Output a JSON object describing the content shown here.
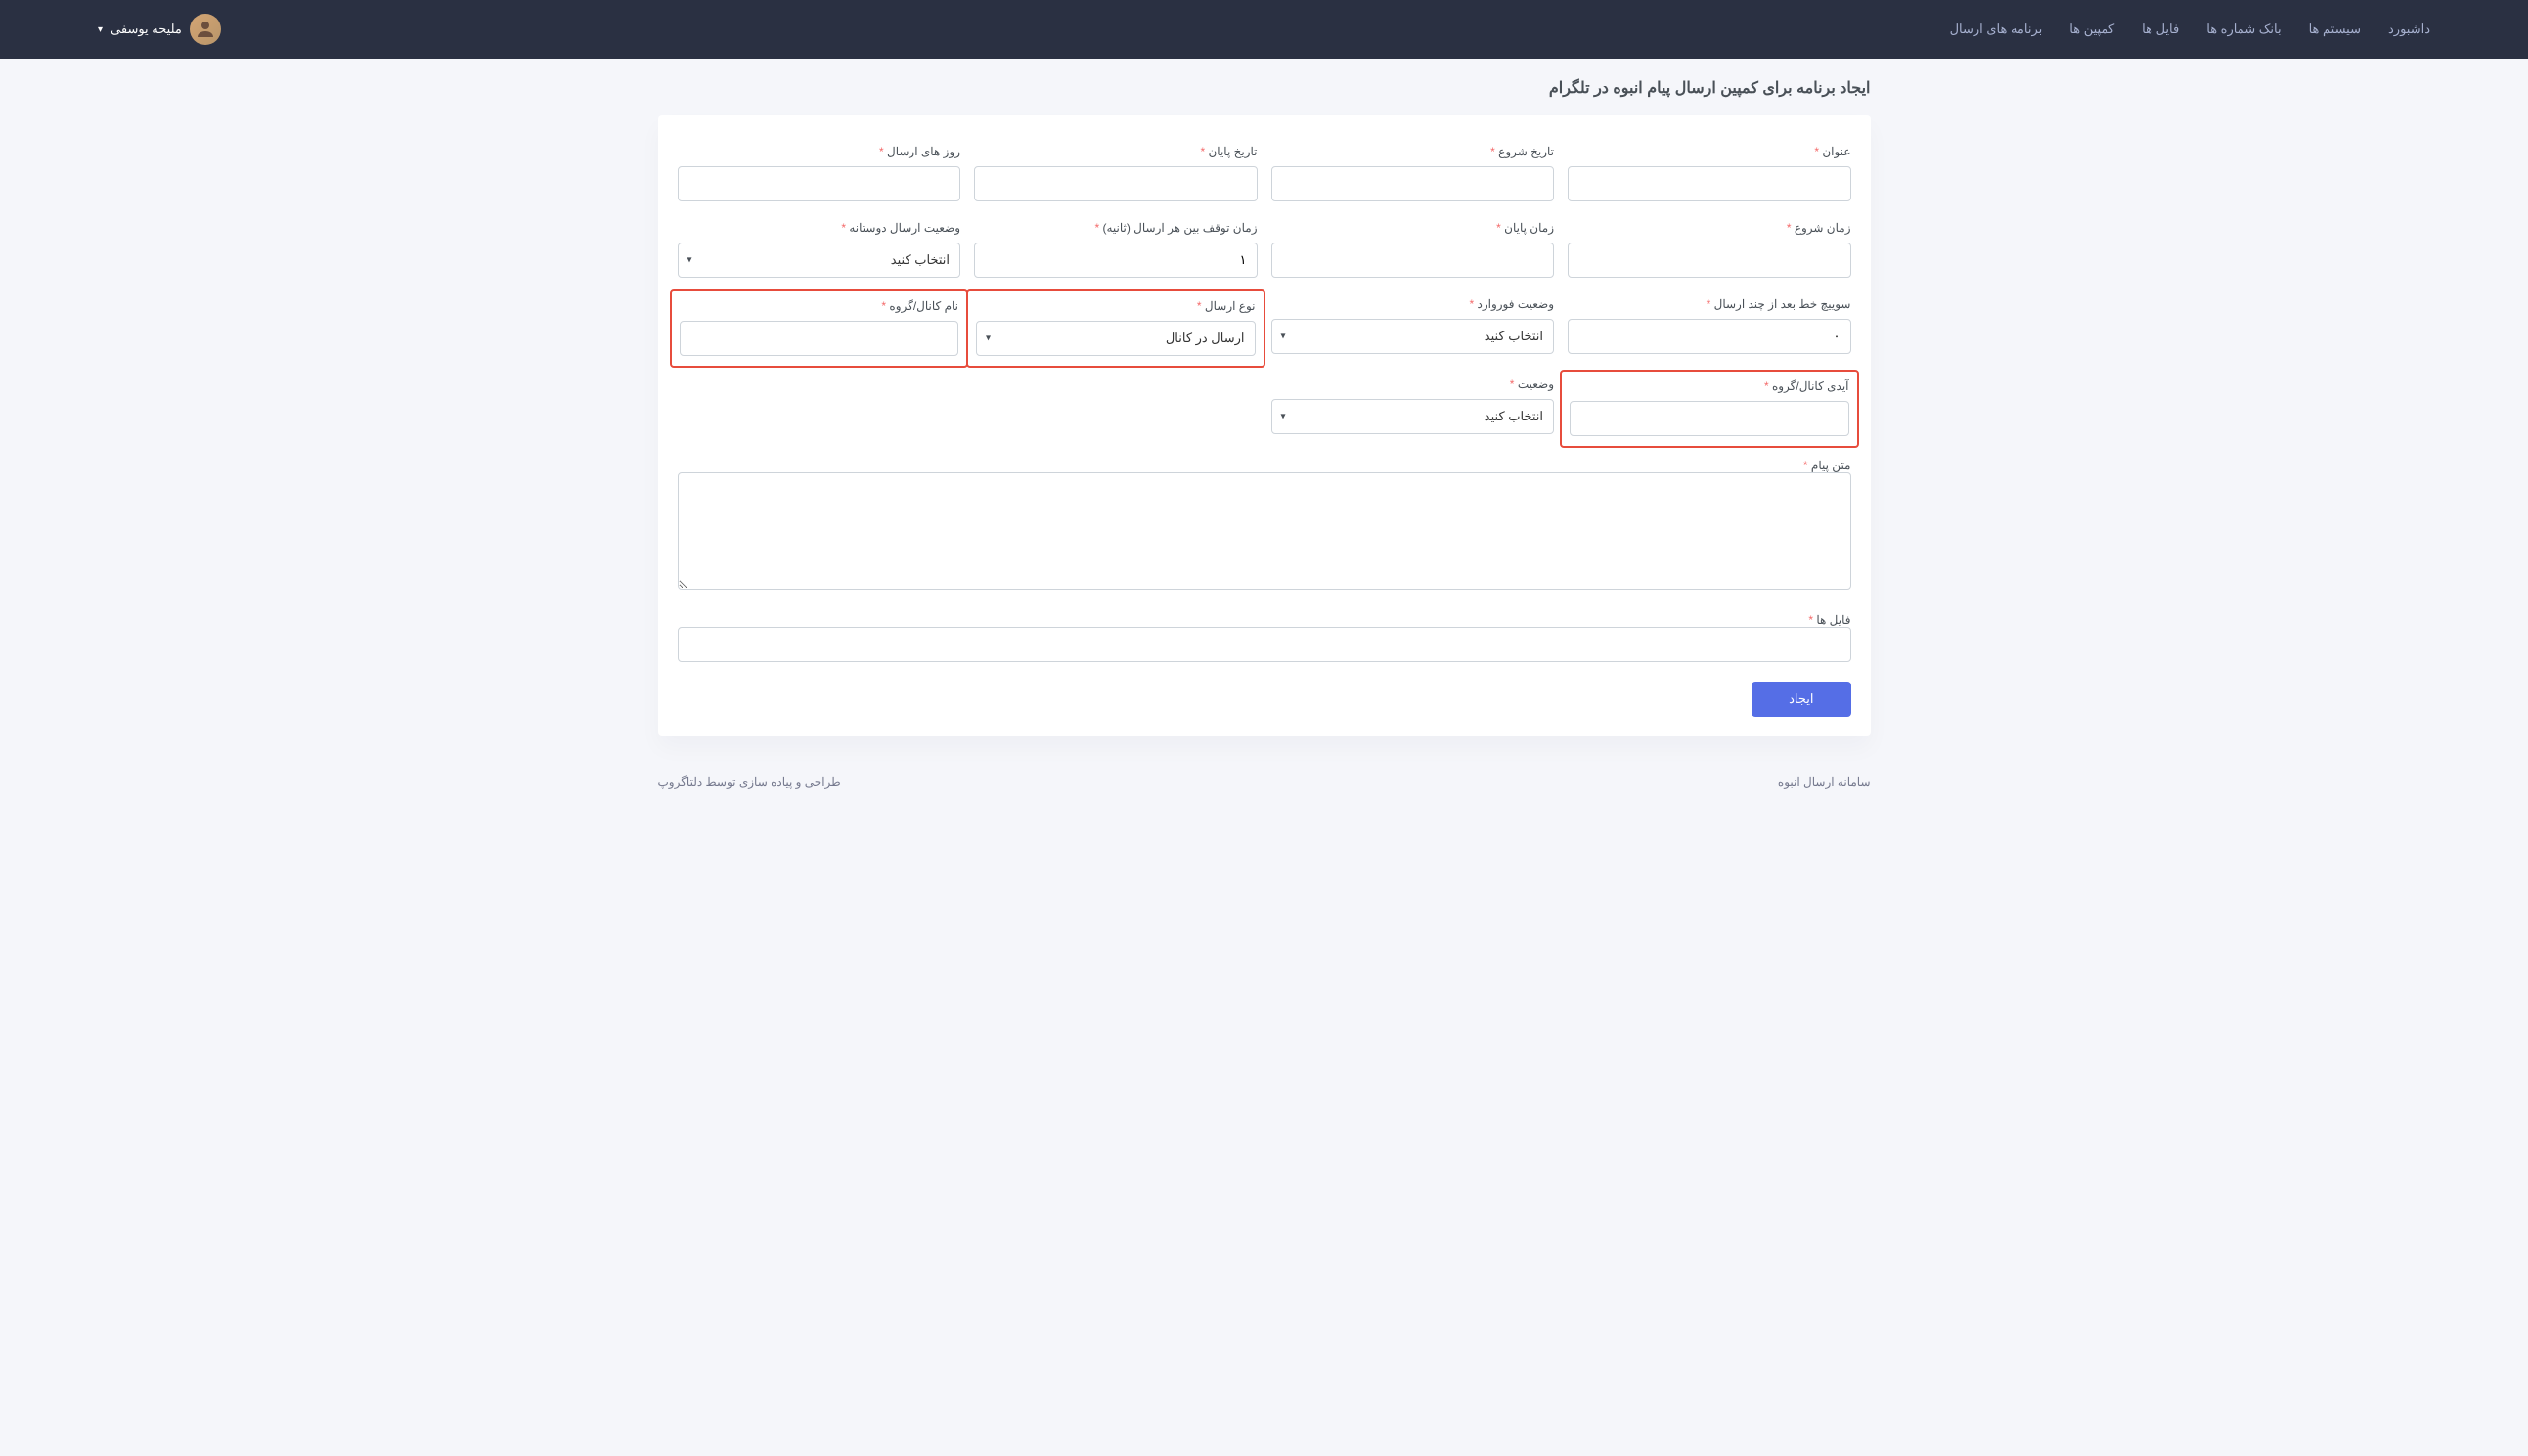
{
  "nav": {
    "items": [
      "داشبورد",
      "سیستم ها",
      "بانک شماره ها",
      "فایل ها",
      "کمپین ها",
      "برنامه های ارسال"
    ]
  },
  "user": {
    "name": "ملیحه یوسفی"
  },
  "page": {
    "title": "ایجاد برنامه برای کمپین ارسال پیام انبوه در تلگرام"
  },
  "form": {
    "labels": {
      "title": "عنوان",
      "start_date": "تاریخ شروع",
      "end_date": "تاریخ پایان",
      "send_days": "روز های ارسال",
      "start_time": "زمان شروع",
      "end_time": "زمان پایان",
      "pause_time": "زمان توقف بین هر ارسال (ثانیه)",
      "friendly_status": "وضعیت ارسال دوستانه",
      "switch_line": "سوییچ خط بعد از چند ارسال",
      "forward_status": "وضعیت فوروارد",
      "send_type": "نوع ارسال",
      "channel_name": "نام کانال/گروه",
      "channel_id": "آیدی کانال/گروه",
      "status": "وضعیت",
      "message_text": "متن پیام",
      "files": "فایل ها"
    },
    "values": {
      "title": "",
      "start_date": "",
      "end_date": "",
      "send_days": "",
      "start_time": "",
      "end_time": "",
      "pause_time": "۱",
      "friendly_status": "انتخاب کنید",
      "switch_line": "۰",
      "forward_status": "انتخاب کنید",
      "send_type": "ارسال در کانال",
      "channel_name": "",
      "channel_id": "",
      "status": "انتخاب کنید",
      "message_text": "",
      "files": ""
    },
    "required_mark": "*",
    "submit": "ایجاد"
  },
  "footer": {
    "right": "سامانه ارسال انبوه",
    "left": "طراحی و پیاده سازی توسط دلتاگروپ"
  }
}
